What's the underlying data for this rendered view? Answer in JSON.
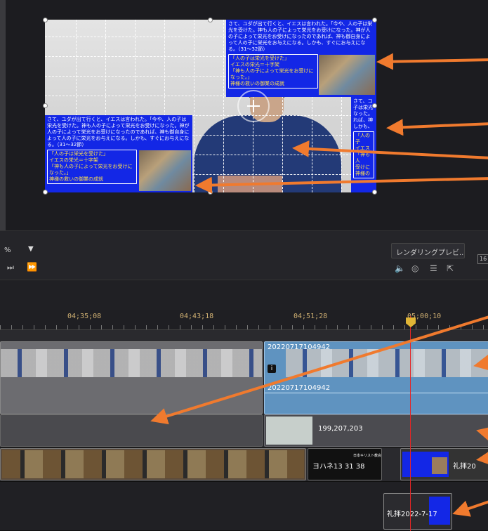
{
  "captions": {
    "top": {
      "body": "さて、ユダが出て行くと、イエスは言われた。「今や、人の子は栄光を受けた。神も人の子によって栄光をお受けになった。神が人の子によって栄光をお受けになったのであれば、神も御自身によって人の子に栄光をお与えになる。しかも、すぐにお与えになる。（31～32節）",
      "box": "「人の子は栄光を受けた」\nイエスの栄光＝十字架\n「神も人の子によって栄光をお受けになった。」\n神様の救いの御業の成就"
    },
    "left": {
      "body": "さて、ユダが出て行くと、イエスは言われた。「今や、人の子は栄光を受けた。神も人の子によって栄光をお受けになった。神が人の子によって栄光をお受けになったのであれば、神も御自身によって人の子に栄光をお与えになる。しかも、すぐにお与えになる。（31～32節）",
      "box": "「人の子は栄光を受けた」\nイエスの栄光＝十字架\n「神も人の子によって栄光をお受けになった。」\n神様の救いの御業の成就"
    },
    "right": {
      "body": "さて、コ\n子は栄光\nなった。\nれば、神\nしかも、",
      "box": "「人の子\nイエス\n「神も人\n受けに\n神様の"
    }
  },
  "controls": {
    "zoom": "%",
    "render_preview": "レンダリングプレビ...",
    "ratio": "16"
  },
  "ruler": {
    "timecodes": [
      "04;35;08",
      "04;43;18",
      "04;51;28",
      "05;00;10"
    ]
  },
  "clips": {
    "video_b_top": "20220717104942",
    "video_b_bottom": "20220717104942",
    "color_clip": "199,207,203",
    "text_clip_b": "ヨハネ13 31 38",
    "text_clip_b_small": "日本キリスト教会",
    "text_clip_c": "礼拝20",
    "title_clip": "礼拝2022-7-17"
  },
  "colors": {
    "caption_bg": "#1327e6",
    "playhead": "#e52525",
    "arrow": "#f07a2e",
    "selected_clip": "#5f93c0"
  }
}
